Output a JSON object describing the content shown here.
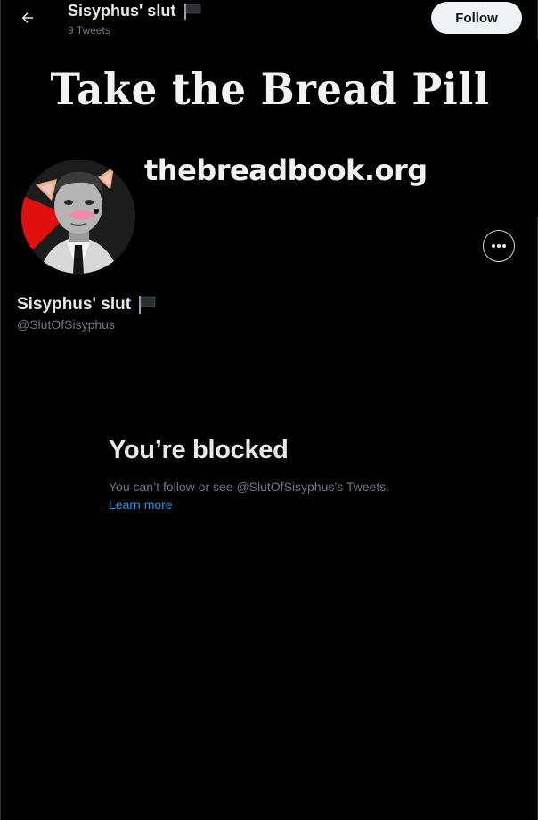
{
  "header": {
    "display_name": "Sisyphus' slut",
    "tweet_count": "9 Tweets",
    "follow_label": "Follow"
  },
  "banner": {
    "title": "Take the Bread Pill",
    "url": "thebreadbook.org"
  },
  "profile": {
    "display_name": "Sisyphus' slut",
    "handle": "@SlutOfSisyphus"
  },
  "blocked": {
    "title": "You’re blocked",
    "message": "You can’t follow or see @SlutOfSisyphus’s Tweets.",
    "link": "Learn more"
  },
  "icons": {
    "back": "back-arrow-icon",
    "flag": "black-flag-icon",
    "more": "more-options-icon"
  },
  "colors": {
    "background": "#000000",
    "text_primary": "#e7e9ea",
    "text_secondary": "#71767b",
    "link": "#1d9bf0",
    "follow_bg": "#eff3f4"
  }
}
